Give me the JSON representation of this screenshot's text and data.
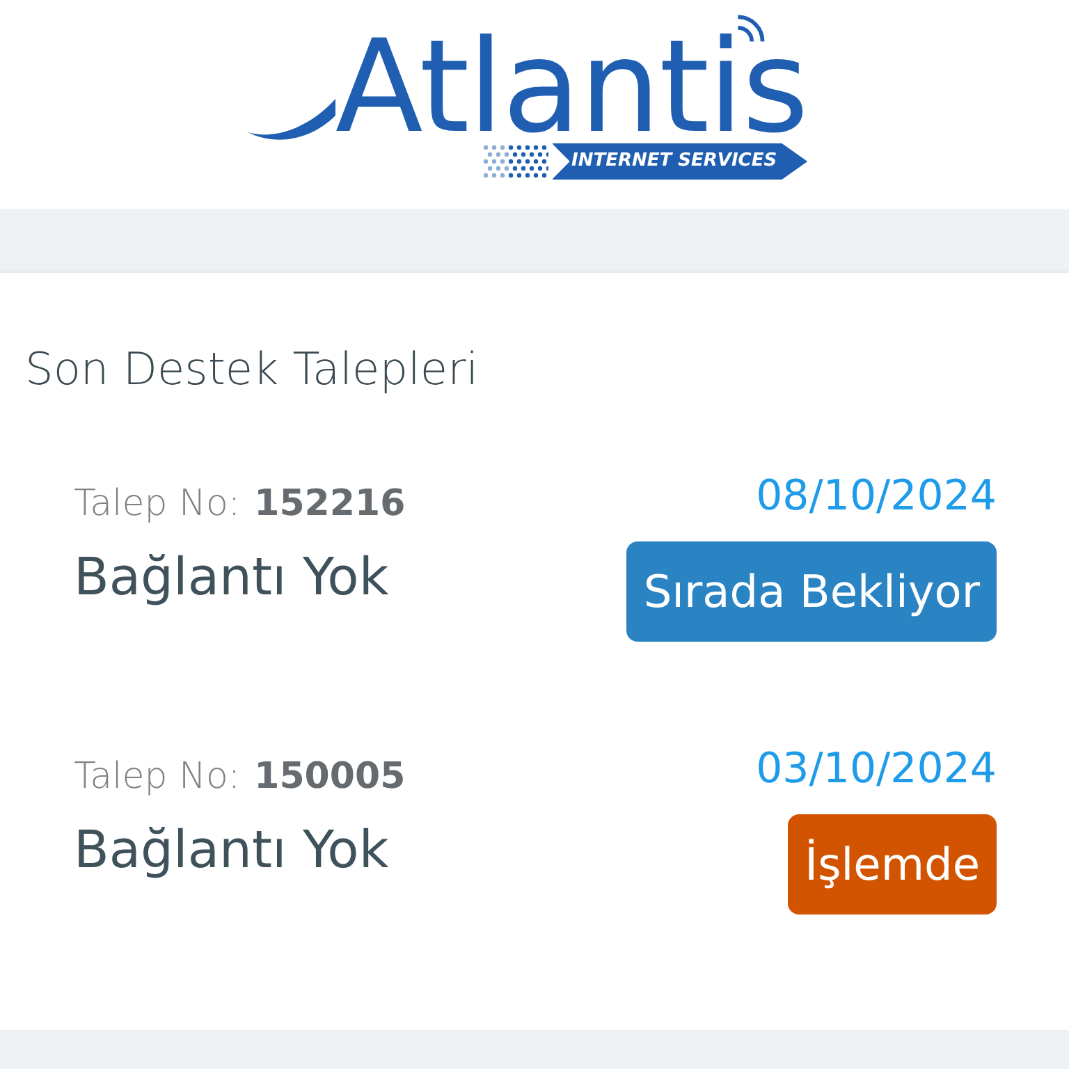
{
  "logo": {
    "wordmark": "Atlantis",
    "tagline": "INTERNET SERVICES"
  },
  "section": {
    "title": "Son Destek Talepleri"
  },
  "tickets": [
    {
      "number_label": "Talep No:",
      "number": "152216",
      "subject": "Bağlantı Yok",
      "date": "08/10/2024",
      "status": {
        "label": "Sırada Bekliyor",
        "color": "#2a84c4"
      }
    },
    {
      "number_label": "Talep No:",
      "number": "150005",
      "subject": "Bağlantı Yok",
      "date": "03/10/2024",
      "status": {
        "label": "İşlemde",
        "color": "#d35400"
      }
    }
  ]
}
